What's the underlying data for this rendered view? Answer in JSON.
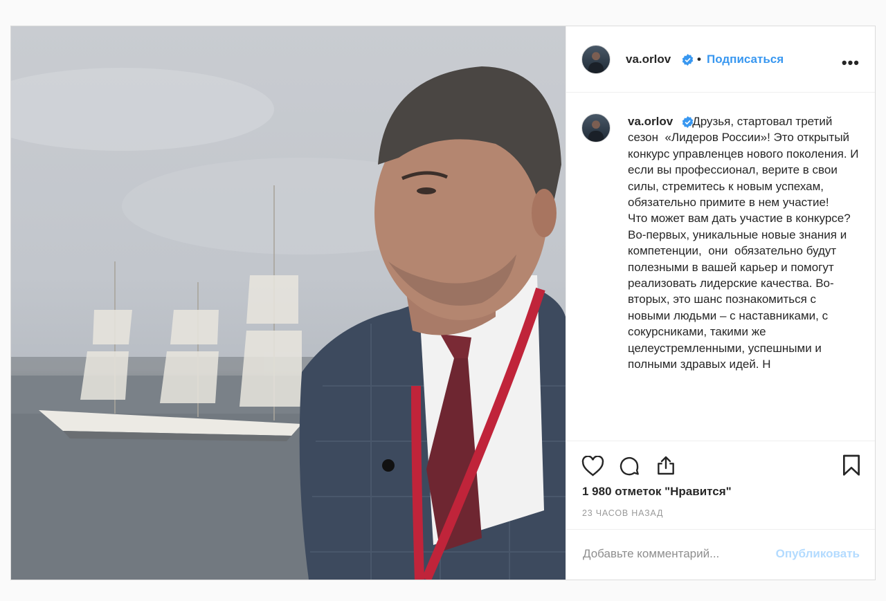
{
  "post": {
    "username": "va.orlov",
    "follow_label": "Подписаться",
    "separator": "•",
    "more_label": "•••",
    "caption_username": "va.orlov",
    "caption_text": "Друзья, стартовал третий сезон  «Лидеров России»! Это открытый конкурс управленцев нового поколения. И если вы профессионал, верите в свои силы, стремитесь к новым успехам, обязательно примите в нем участие!\nЧто может вам дать участие в конкурсе? Во-первых, уникальные новые знания и компетенции,  они  обязательно будут полезными в вашей карьер и помогут реализовать лидерские качества. Во-вторых, это шанс познакомиться с новыми людьми – с наставниками, с сокурсниками, такими же целеустремленными, успешными и  полными здравых идей. Н",
    "likes": "1 980 отметок \"Нравится\"",
    "time": "23 ЧАСОВ НАЗАД",
    "comment_placeholder": "Добавьте комментарий...",
    "publish_label": "Опубликовать"
  },
  "icons": {
    "verified": "verified-badge-icon",
    "like": "heart-icon",
    "comment": "comment-bubble-icon",
    "share": "share-icon",
    "save": "bookmark-icon",
    "more": "more-options-icon"
  },
  "colors": {
    "link": "#3897f0",
    "publish_disabled": "#b3dbff",
    "text": "#262626",
    "muted": "#999999",
    "border": "#efefef"
  }
}
